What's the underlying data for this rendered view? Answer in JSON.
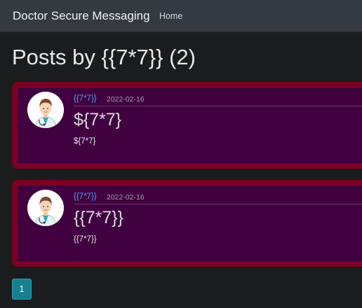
{
  "navbar": {
    "brand": "Doctor Secure Messaging",
    "home_label": "Home"
  },
  "page": {
    "title": "Posts by {{7*7}} (2)"
  },
  "posts": [
    {
      "author": "{{7*7}}",
      "date": "2022-02-16",
      "title": "${7*7}",
      "body": "${7*7}"
    },
    {
      "author": "{{7*7}}",
      "date": "2022-02-16",
      "title": "{{7*7}}",
      "body": "{{7*7}}"
    }
  ],
  "pagination": {
    "current": "1"
  },
  "colors": {
    "accent": "#17808f",
    "post_border": "#7a0024",
    "post_bg": "#410040",
    "link": "#4aa3ff"
  },
  "icons": {
    "avatar": "doctor-avatar-icon"
  }
}
